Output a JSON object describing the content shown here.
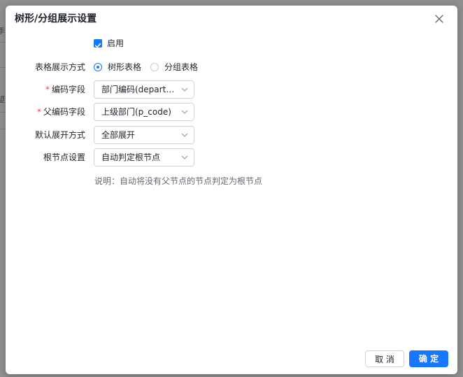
{
  "dialog": {
    "title": "树形/分组展示设置",
    "enable_label": "启用",
    "enable_checked": true,
    "fields": {
      "display_mode": {
        "label": "表格展示方式",
        "options": [
          "树形表格",
          "分组表格"
        ],
        "selected": "树形表格"
      },
      "code_field": {
        "label": "编码字段",
        "required": true,
        "value": "部门编码(departm..."
      },
      "parent_code_field": {
        "label": "父编码字段",
        "required": true,
        "value": "上级部门(p_code)"
      },
      "expand_mode": {
        "label": "默认展开方式",
        "value": "全部展开"
      },
      "root_node": {
        "label": "根节点设置",
        "value": "自动判定根节点"
      }
    },
    "note": "说明：自动将没有父节点的节点判定为根节点",
    "buttons": {
      "cancel": "取 消",
      "confirm": "确 定"
    }
  },
  "background": {
    "glyph_1": "季",
    "glyph_2": "望"
  },
  "colors": {
    "primary": "#1677ff",
    "required": "#e5484d",
    "text": "#1f2329",
    "muted": "#646a73"
  }
}
